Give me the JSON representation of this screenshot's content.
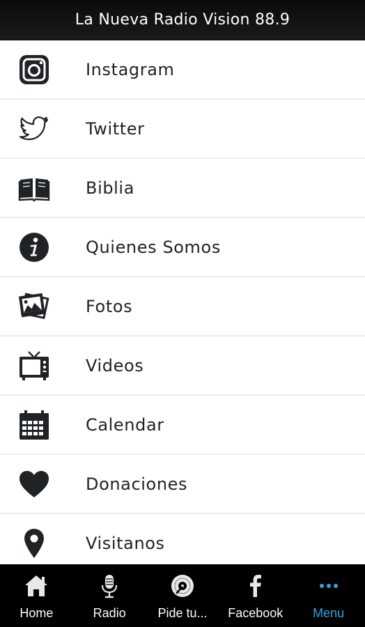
{
  "header": {
    "title": "La Nueva Radio Vision 88.9"
  },
  "menu": {
    "items": [
      {
        "label": "Instagram",
        "icon": "instagram-icon"
      },
      {
        "label": "Twitter",
        "icon": "twitter-icon"
      },
      {
        "label": "Biblia",
        "icon": "book-icon"
      },
      {
        "label": "Quienes Somos",
        "icon": "info-icon"
      },
      {
        "label": "Fotos",
        "icon": "photos-icon"
      },
      {
        "label": "Videos",
        "icon": "tv-icon"
      },
      {
        "label": "Calendar",
        "icon": "calendar-icon"
      },
      {
        "label": "Donaciones",
        "icon": "heart-icon"
      },
      {
        "label": "Visitanos",
        "icon": "location-pin-icon"
      }
    ]
  },
  "tabbar": {
    "tabs": [
      {
        "label": "Home",
        "icon": "home-icon"
      },
      {
        "label": "Radio",
        "icon": "microphone-icon"
      },
      {
        "label": "Pide tu...",
        "icon": "vinyl-record-icon"
      },
      {
        "label": "Facebook",
        "icon": "facebook-icon"
      },
      {
        "label": "Menu",
        "icon": "more-dots-icon",
        "active": true
      }
    ]
  },
  "colors": {
    "accent": "#2ba8e0",
    "header_bg": "#111111",
    "tabbar_bg": "#000000",
    "icon": "#1f2326"
  }
}
